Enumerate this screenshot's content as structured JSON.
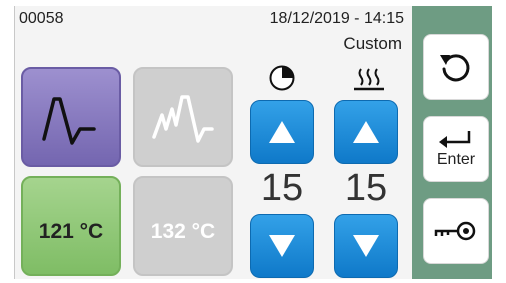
{
  "header": {
    "id": "00058",
    "datetime": "18/12/2019 - 14:15",
    "mode": "Custom"
  },
  "tiles": {
    "cycle_active_icon": "pulse-wave-icon",
    "cycle_inactive_icon": "multi-pulse-wave-icon",
    "temp_active": "121 °C",
    "temp_inactive": "132 °C"
  },
  "controls": {
    "timer": {
      "icon": "timer-icon",
      "value": "15"
    },
    "drying": {
      "icon": "drying-heat-icon",
      "value": "15"
    }
  },
  "side": {
    "back_icon": "undo-arrow-icon",
    "enter_label": "Enter",
    "key_icon": "key-icon"
  },
  "colors": {
    "accent_blue": "#1a8ad8",
    "active_purple": "#8a7cc1",
    "active_green": "#8fc775",
    "inactive_gray": "#cfcfcf",
    "side_panel": "#6e9c83"
  }
}
